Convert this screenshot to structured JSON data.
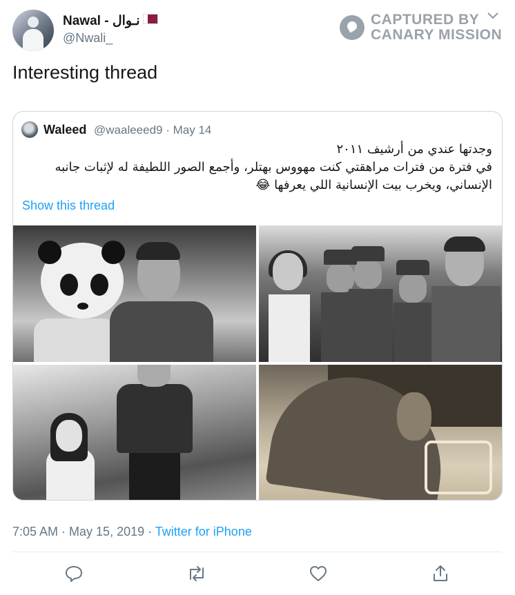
{
  "tweet": {
    "author_name": "Nawal - نـوال",
    "author_handle": "@Nwali_",
    "text": "Interesting thread",
    "watermark_line1": "CAPTURED BY",
    "watermark_line2": "CANARY MISSION",
    "timestamp": "7:05 AM · May 15, 2019 · ",
    "source": "Twitter for iPhone"
  },
  "quoted": {
    "name": "Waleed",
    "handle": "@waaleeed9",
    "date": "· May 14",
    "line1": "وجدتها عندي من أرشيف ٢٠١١",
    "line2": "في فترة من فترات مراهقتي كنت مهووس بهتلر، وأجمع الصور اللطيفة له لإثبات جانبه الإنساني، ويخرب بيت الإنسانية اللي يعرفها 😂",
    "show_thread": "Show this thread"
  },
  "actions": [
    "reply-icon",
    "retweet-icon",
    "like-icon",
    "share-icon"
  ],
  "colors": {
    "link": "#1da1f2",
    "muted": "#657786",
    "border": "#ccd6dd",
    "flag": "#8d1b3d"
  }
}
